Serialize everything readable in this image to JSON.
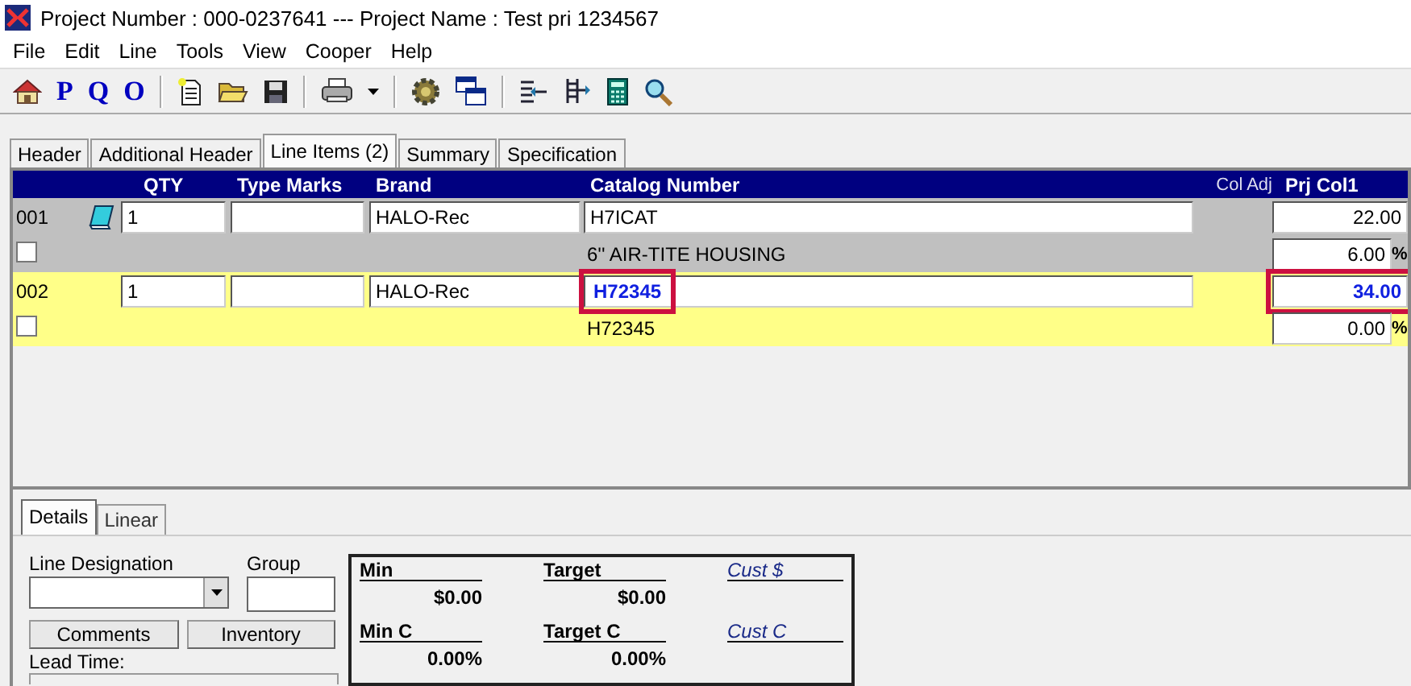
{
  "window": {
    "title": "Project Number : 000-0237641 --- Project Name : Test pri 1234567"
  },
  "menu": [
    "File",
    "Edit",
    "Line",
    "Tools",
    "View",
    "Cooper",
    "Help"
  ],
  "toolbar_letters": [
    "P",
    "Q",
    "O"
  ],
  "tabs": [
    {
      "label": "Header",
      "selected": false
    },
    {
      "label": "Additional Header",
      "selected": false
    },
    {
      "label": "Line Items (2)",
      "selected": true
    },
    {
      "label": "Summary",
      "selected": false
    },
    {
      "label": "Specification",
      "selected": false
    }
  ],
  "columns": [
    "QTY",
    "Type Marks",
    "Brand",
    "Catalog Number",
    "Col Adj",
    "Prj Col1"
  ],
  "line_items": [
    {
      "number": "001",
      "has_note": true,
      "qty": "1",
      "brand": "HALO-Rec",
      "catalog": "H7ICAT",
      "description": "6'' AIR-TITE HOUSING",
      "price": "22.00",
      "percent": "6.00",
      "unit": "%",
      "checked": false,
      "selected": false,
      "highlighted": false
    },
    {
      "number": "002",
      "has_note": false,
      "qty": "1",
      "brand": "HALO-Rec",
      "catalog": "H72345",
      "description": "H72345",
      "price": "34.00",
      "percent": "0.00",
      "unit": "%",
      "checked": false,
      "selected": true,
      "highlighted": true
    }
  ],
  "detail_tabs": [
    {
      "label": "Details",
      "selected": true
    },
    {
      "label": "Linear",
      "selected": false
    }
  ],
  "details": {
    "line_designation_label": "Line Designation",
    "group_label": "Group",
    "buttons": [
      "Comments",
      "Inventory"
    ],
    "lead_time_label": "Lead Time:"
  },
  "pricing": [
    {
      "label": "Min",
      "value": "$0.00",
      "kind": "value"
    },
    {
      "label": "Target",
      "value": "$0.00",
      "kind": "value"
    },
    {
      "label": "Cust $",
      "kind": "custom"
    },
    {
      "label": "Min C",
      "value": "0.00%",
      "kind": "value"
    },
    {
      "label": "Target C",
      "value": "0.00%",
      "kind": "value"
    },
    {
      "label": "Cust C",
      "kind": "custom"
    }
  ]
}
